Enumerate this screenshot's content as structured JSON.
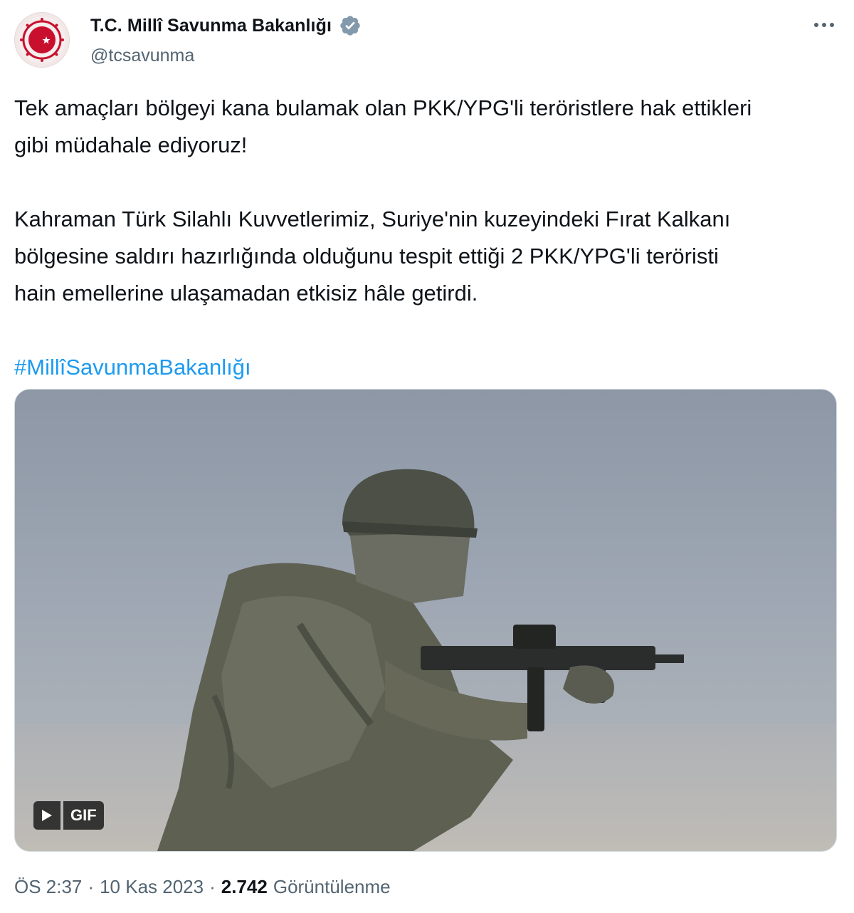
{
  "account": {
    "display_name": "T.C. Millî Savunma Bakanlığı",
    "handle": "@tcsavunma",
    "verified": true,
    "avatar_icon": "ministry-emblem-icon",
    "verified_icon": "verified-badge-icon"
  },
  "tweet": {
    "line1": "Tek amaçları bölgeyi kana bulamak olan PKK/YPG'li teröristlere hak ettikleri",
    "line2": "gibi müdahale ediyoruz!",
    "line3": "Kahraman Türk Silahlı Kuvvetlerimiz, Suriye'nin kuzeyindeki Fırat Kalkanı",
    "line4": "bölgesine saldırı hazırlığında olduğunu tespit ettiği 2 PKK/YPG'li teröristi",
    "line5": "hain emellerine ulaşamadan etkisiz hâle getirdi.",
    "hashtag": "#MillîSavunmaBakanlığı"
  },
  "media": {
    "badge_label": "GIF",
    "play_icon": "play-icon"
  },
  "meta": {
    "time": "ÖS 2:37",
    "sep1": "·",
    "date": "10 Kas 2023",
    "sep2": "·",
    "views_count": "2.742",
    "views_label": "Görüntülenme"
  },
  "colors": {
    "text": "#0f1419",
    "secondary": "#536471",
    "link": "#1d9bf0",
    "verified": "#829aab"
  }
}
